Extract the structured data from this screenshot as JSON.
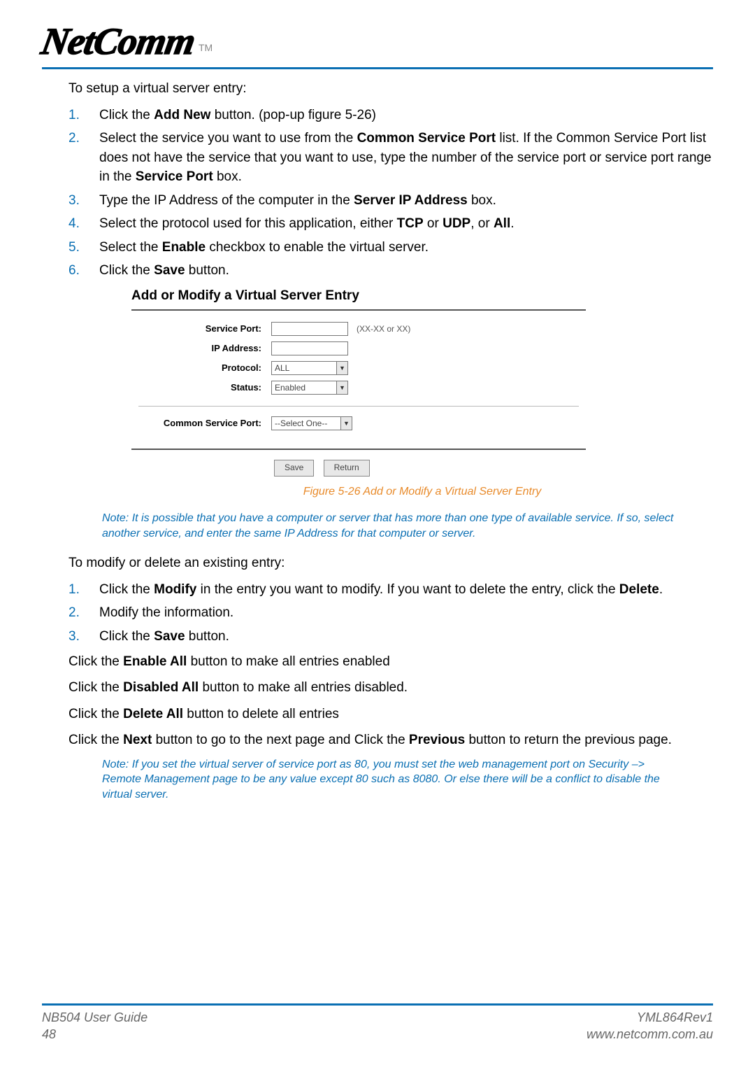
{
  "brand": {
    "name": "NetComm",
    "tm": "TM"
  },
  "setup": {
    "heading": "To setup a virtual server entry:",
    "steps": {
      "s1_a": "Click the ",
      "s1_b": "Add New",
      "s1_c": " button. (pop-up figure 5-26)",
      "s2_a": "Select the service you want to use from the ",
      "s2_b": "Common Service Port",
      "s2_c": " list. If the Common Service Port list does not have the service that you want to use, type the number of the service port or service port range in the ",
      "s2_d": "Service Port",
      "s2_e": " box.",
      "s3_a": "Type the IP Address of the computer in the ",
      "s3_b": "Server IP Address",
      "s3_c": " box.",
      "s4_a": "Select the protocol used for this application, either ",
      "s4_b": "TCP",
      "s4_c": " or ",
      "s4_d": "UDP",
      "s4_e": ", or ",
      "s4_f": "All",
      "s4_g": ".",
      "s5_a": "Select the ",
      "s5_b": "Enable",
      "s5_c": " checkbox to enable the virtual server.",
      "s6_a": "Click the ",
      "s6_b": "Save",
      "s6_c": " button."
    }
  },
  "figure": {
    "title": "Add or Modify a Virtual Server Entry",
    "labels": {
      "service_port": "Service Port:",
      "ip_address": "IP Address:",
      "protocol": "Protocol:",
      "status": "Status:",
      "common_service_port": "Common Service Port:"
    },
    "hint": "(XX-XX or XX)",
    "protocol_value": "ALL",
    "status_value": "Enabled",
    "csp_value": "--Select One--",
    "buttons": {
      "save": "Save",
      "return": "Return"
    },
    "caption": "Figure 5-26 Add or Modify a Virtual Server Entry"
  },
  "note1": "Note: It is possible that you have a computer or server that has more than one type of available service. If so, select another service, and enter the same IP Address for that computer or server.",
  "modify": {
    "heading": "To modify or delete an existing entry:",
    "steps": {
      "m1_a": "Click the ",
      "m1_b": "Modify",
      "m1_c": " in the entry you want to modify. If you want to delete the entry, click the ",
      "m1_d": "Delete",
      "m1_e": ".",
      "m2": "Modify the information.",
      "m3_a": "Click the ",
      "m3_b": "Save",
      "m3_c": " button."
    }
  },
  "paras": {
    "p1_a": "Click the ",
    "p1_b": "Enable All",
    "p1_c": " button to make all entries enabled",
    "p2_a": "Click the ",
    "p2_b": "Disabled All",
    "p2_c": " button to make all entries disabled.",
    "p3_a": "Click the ",
    "p3_b": "Delete All",
    "p3_c": " button to delete all entries",
    "p4_a": "Click the ",
    "p4_b": "Next",
    "p4_c": " button to go to the next page and Click the ",
    "p4_d": "Previous",
    "p4_e": " button to return the previous page."
  },
  "note2": "Note: If you set the virtual server of service port as 80, you must set the web management port on Security –> Remote Management page to be any value except 80 such as 8080. Or else there will be a conflict to disable the virtual server.",
  "footer": {
    "guide": "NB504 User Guide",
    "page": "48",
    "rev": "YML864Rev1",
    "url": "www.netcomm.com.au"
  }
}
